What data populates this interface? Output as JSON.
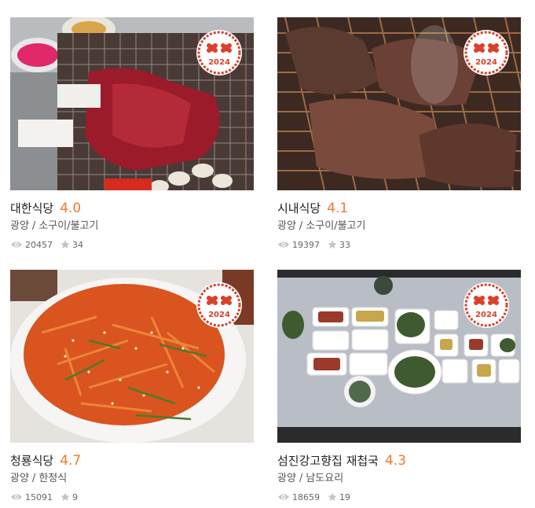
{
  "restaurants": [
    {
      "name": "대한식당",
      "rating": "4.0",
      "region": "광양",
      "category": "소구이/불고기",
      "views": "20457",
      "reviews": "34",
      "badge_year": "2024",
      "badge_icon": "double-flower-icon",
      "photo": "grilled-beef-on-grill-photo"
    },
    {
      "name": "시내식당",
      "rating": "4.1",
      "region": "광양",
      "category": "소구이/불고기",
      "views": "19397",
      "reviews": "33",
      "badge_year": "2024",
      "badge_icon": "double-flower-icon",
      "photo": "beef-on-copper-grill-photo"
    },
    {
      "name": "청룡식당",
      "rating": "4.7",
      "region": "광양",
      "category": "한정식",
      "views": "15091",
      "reviews": "9",
      "badge_year": "2024",
      "badge_icon": "double-flower-icon",
      "photo": "spicy-salad-dish-photo"
    },
    {
      "name": "섬진강고향집 재첩국",
      "rating": "4.3",
      "region": "광양",
      "category": "남도요리",
      "views": "18659",
      "reviews": "19",
      "badge_year": "2024",
      "badge_icon": "double-flower-icon",
      "photo": "korean-table-set-photo"
    }
  ],
  "separator": "/",
  "colors": {
    "rating": "#f5772b",
    "badge": "#d9412b",
    "meta_icon": "#bbbbbb"
  }
}
